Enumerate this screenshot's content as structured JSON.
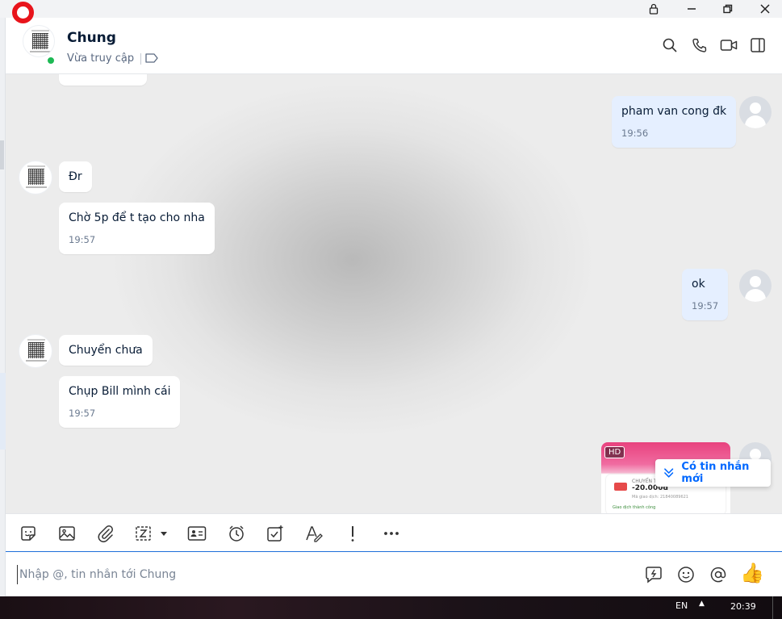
{
  "window": {
    "lock_label": "lock",
    "minimize_label": "minimize",
    "restore_label": "restore",
    "close_label": "close"
  },
  "header": {
    "contact_name": "Chung",
    "status": "Vừa truy cập",
    "icons": [
      "search-icon",
      "phone-icon",
      "video-icon",
      "sidebar-toggle-icon"
    ]
  },
  "messages": {
    "mine_1": {
      "text": "pham van cong đk",
      "time": "19:56"
    },
    "their_1": {
      "text": "Đr"
    },
    "their_2": {
      "text": "Chờ 5p để t tạo cho nha",
      "time": "19:57"
    },
    "mine_2": {
      "text": "ok",
      "time": "19:57"
    },
    "their_3": {
      "text": "Chuyển chưa"
    },
    "their_4": {
      "text": "Chụp Bill mình cái",
      "time": "19:57"
    },
    "image": {
      "badge": "HD",
      "receipt_label": "CHUYỂN T",
      "receipt_amount": "-20.000đ",
      "receipt_code": "Mã giao dịch: 21840089621",
      "receipt_status": "Giao dịch thành công"
    }
  },
  "new_message_pill": "Có tin nhắn mới",
  "composer": {
    "placeholder": "Nhập @, tin nhắn tới Chung"
  },
  "taskbar": {
    "language": "EN",
    "caret": "▲",
    "clock": "20:39"
  },
  "colors": {
    "accent": "#0068ff",
    "online": "#1db954",
    "my_bubble": "#e5efff"
  }
}
